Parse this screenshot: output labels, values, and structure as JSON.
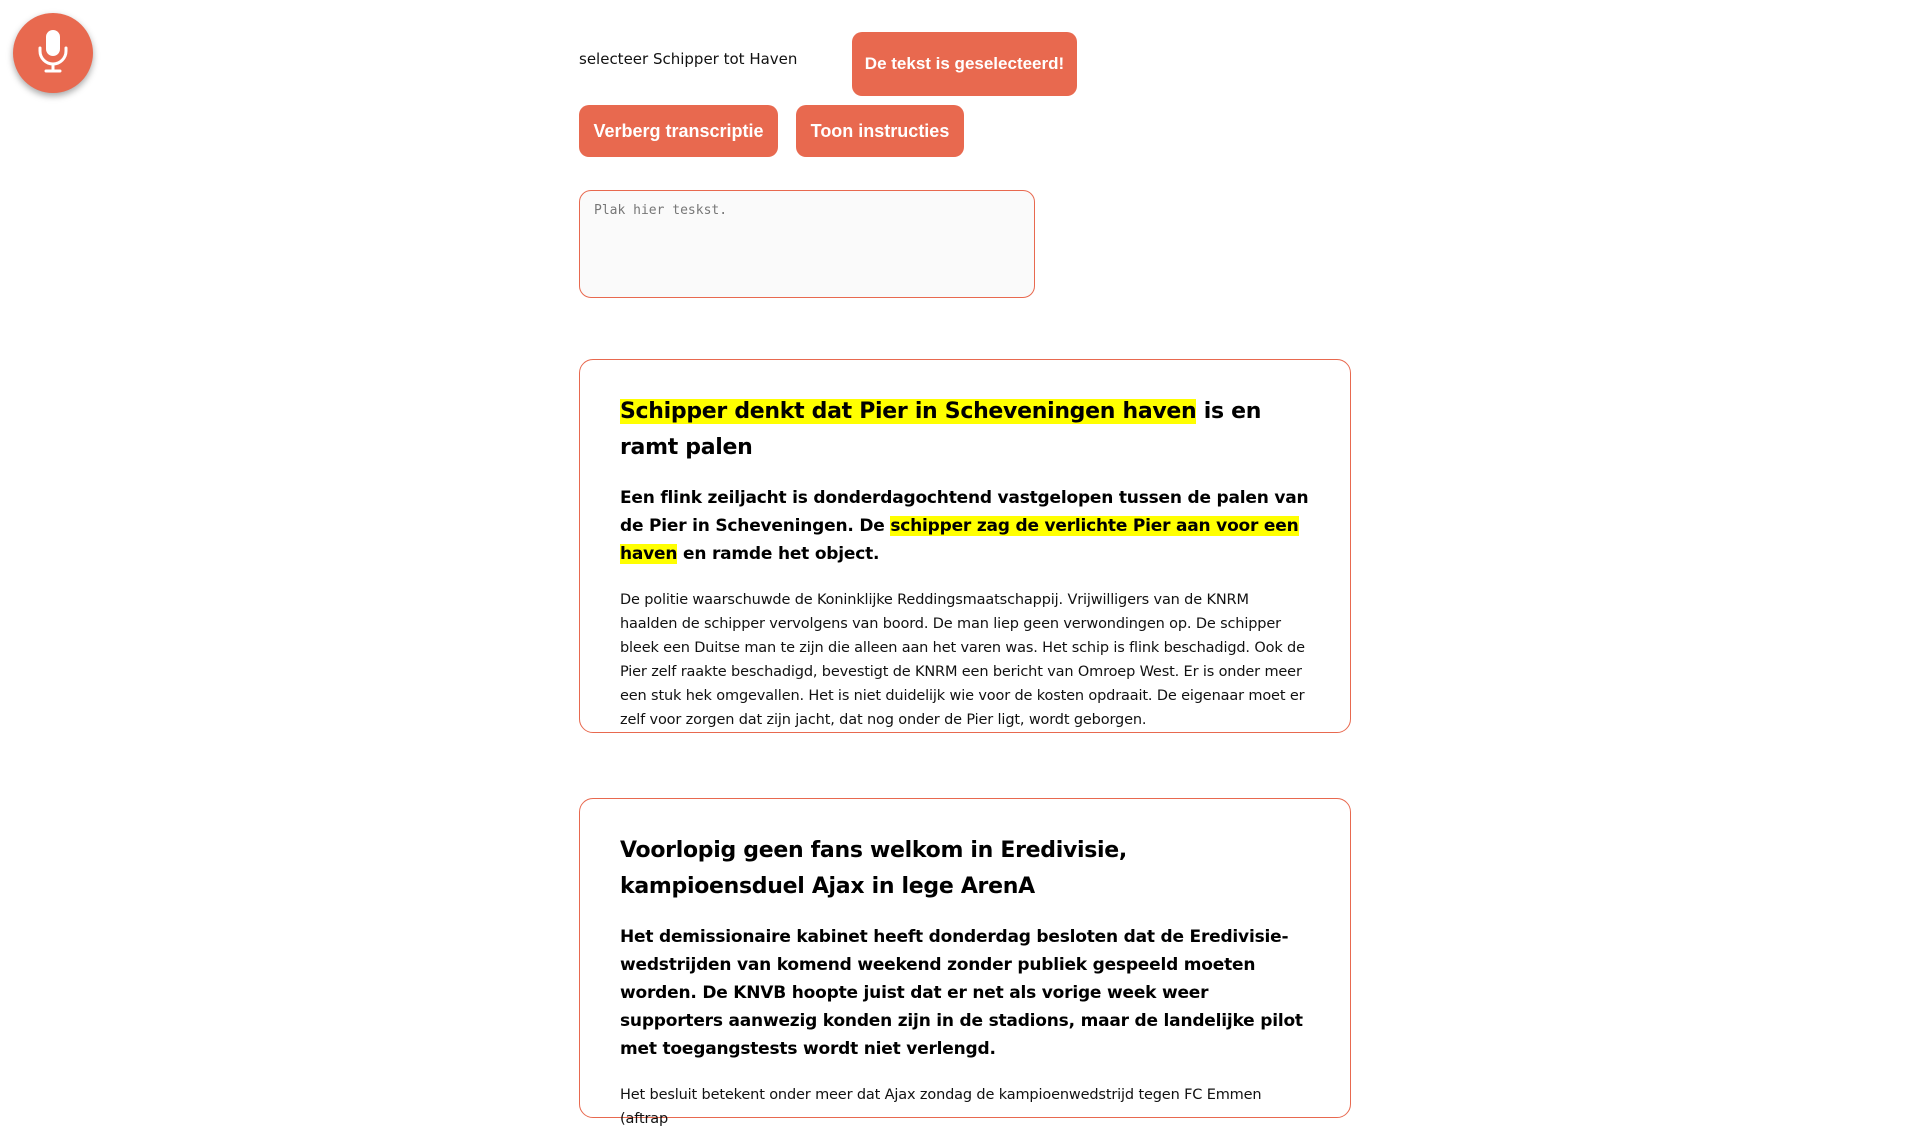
{
  "mic": {
    "icon": "microphone-icon",
    "color": "#e8694f"
  },
  "status": {
    "command_text": "selecteer Schipper tot Haven",
    "selected_message": "De tekst is geselecteerd!"
  },
  "buttons": {
    "hide_transcription": "Verberg transcriptie",
    "show_instructions": "Toon instructies"
  },
  "paste": {
    "placeholder": "Plak hier teskst."
  },
  "colors": {
    "accent": "#e8694f",
    "highlight": "#ffff00"
  },
  "articles": [
    {
      "title_highlight": "Schipper denkt dat Pier in Scheveningen haven",
      "title_rest": " is en ramt palen",
      "lead_before": "Een flink zeiljacht is donderdagochtend vastgelopen tussen de palen van de Pier in Scheveningen. De ",
      "lead_highlight": "schipper zag de verlichte Pier aan voor een haven",
      "lead_after": " en ramde het object.",
      "body": "De politie waarschuwde de Koninklijke Reddingsmaatschappij. Vrijwilligers van de KNRM haalden de schipper vervolgens van boord. De man liep geen verwondingen op. De schipper bleek een Duitse man te zijn die alleen aan het varen was. Het schip is flink beschadigd. Ook de Pier zelf raakte beschadigd, bevestigt de KNRM een bericht van Omroep West. Er is onder meer een stuk hek omgevallen. Het is niet duidelijk wie voor de kosten opdraait. De eigenaar moet er zelf voor zorgen dat zijn jacht, dat nog onder de Pier ligt, wordt geborgen."
    },
    {
      "title": "Voorlopig geen fans welkom in Eredivisie, kampioensduel Ajax in lege ArenA",
      "lead": "Het demissionaire kabinet heeft donderdag besloten dat de Eredivisie-wedstrijden van komend weekend zonder publiek gespeeld moeten worden. De KNVB hoopte juist dat er net als vorige week weer supporters aanwezig konden zijn in de stadions, maar de landelijke pilot met toegangstests wordt niet verlengd.",
      "body": "Het besluit betekent onder meer dat Ajax zondag de kampioenwedstrijd tegen FC Emmen (aftrap"
    }
  ]
}
